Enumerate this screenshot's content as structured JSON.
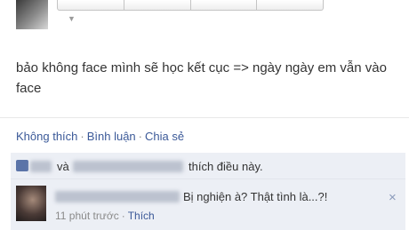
{
  "post": {
    "text": "bảo không face mình sẽ học kết cục => ngày ngày em vẫn vào face"
  },
  "actions": {
    "dislike": "Không thích",
    "comment": "Bình luận",
    "share": "Chia sẻ",
    "separator": "·"
  },
  "likes": {
    "and_word": "và",
    "suffix": "thích điều này."
  },
  "comment": {
    "text": "Bị nghiện à? Thật tình là...?!",
    "time": "11 phút trước",
    "like_label": "Thích",
    "separator": "·",
    "close_icon": "×"
  },
  "icons": {
    "like": "thumbs-up-icon",
    "close": "close-icon"
  },
  "colors": {
    "link": "#3b5998",
    "panel": "#eceff5"
  }
}
